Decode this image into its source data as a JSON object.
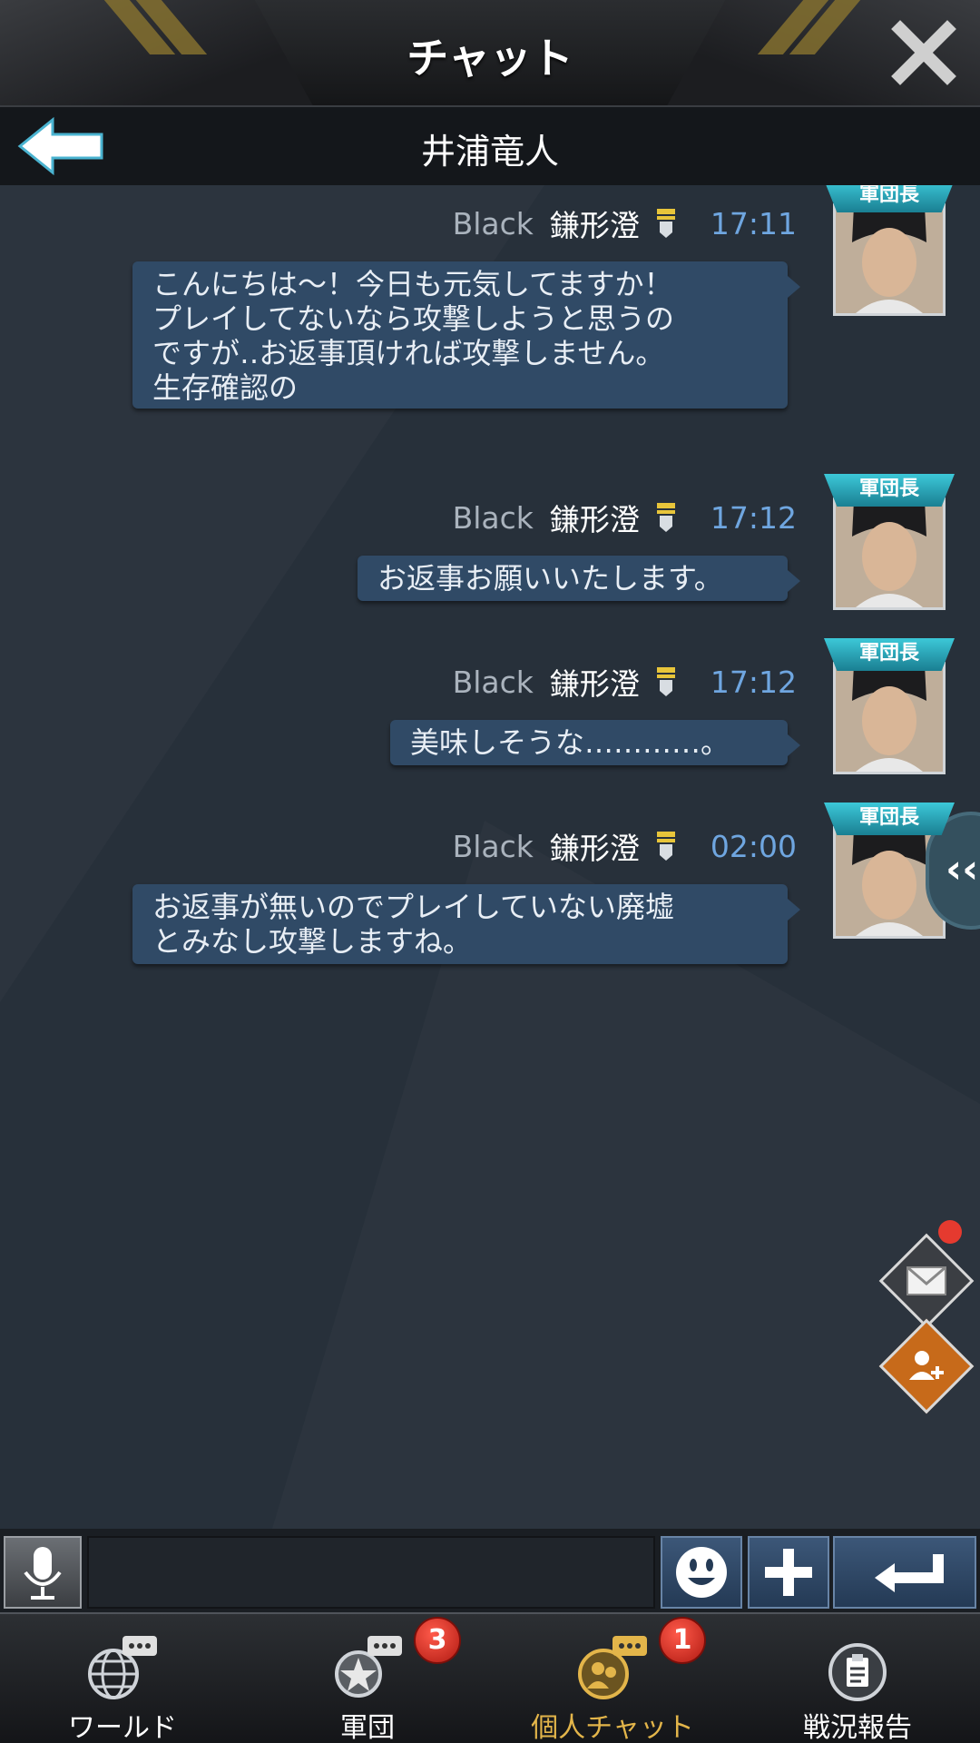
{
  "header": {
    "title": "チャット",
    "close_icon": "close-icon"
  },
  "subheader": {
    "title": "井浦竜人",
    "back_icon": "back-arrow-icon"
  },
  "messages": [
    {
      "sender": "Black",
      "name": "鎌形澄",
      "time": "17:11",
      "badge": "軍団長",
      "lines": [
        "こんにちは～！今日も元気してますか！",
        "プレイしてないなら攻撃しようと思うの",
        "ですが‥お返事頂ければ攻撃しません。",
        "生存確認の"
      ]
    },
    {
      "sender": "Black",
      "name": "鎌形澄",
      "time": "17:12",
      "badge": "軍団長",
      "lines": [
        "お返事お願いいたします。"
      ]
    },
    {
      "sender": "Black",
      "name": "鎌形澄",
      "time": "17:12",
      "badge": "軍団長",
      "lines": [
        "美味しそうな…………。"
      ]
    },
    {
      "sender": "Black",
      "name": "鎌形澄",
      "time": "02:00",
      "badge": "軍団長",
      "lines": [
        "お返事が無いのでプレイしていない廃墟",
        "とみなし攻撃しますね。"
      ]
    }
  ],
  "side_tab": {
    "label": "‹‹"
  },
  "input": {
    "value": "",
    "placeholder": ""
  },
  "nav": [
    {
      "label": "ワールド",
      "icon": "world-chat-icon",
      "badge": ""
    },
    {
      "label": "軍団",
      "icon": "legion-chat-icon",
      "badge": "3"
    },
    {
      "label": "個人チャット",
      "icon": "personal-chat-icon",
      "badge": "1"
    },
    {
      "label": "戦況報告",
      "icon": "battle-report-icon",
      "badge": ""
    }
  ],
  "colors": {
    "accent_time": "#6fa6e0",
    "bubble": "#304a66",
    "active_nav": "#e3b54a",
    "badge_red": "#e53a2f"
  }
}
